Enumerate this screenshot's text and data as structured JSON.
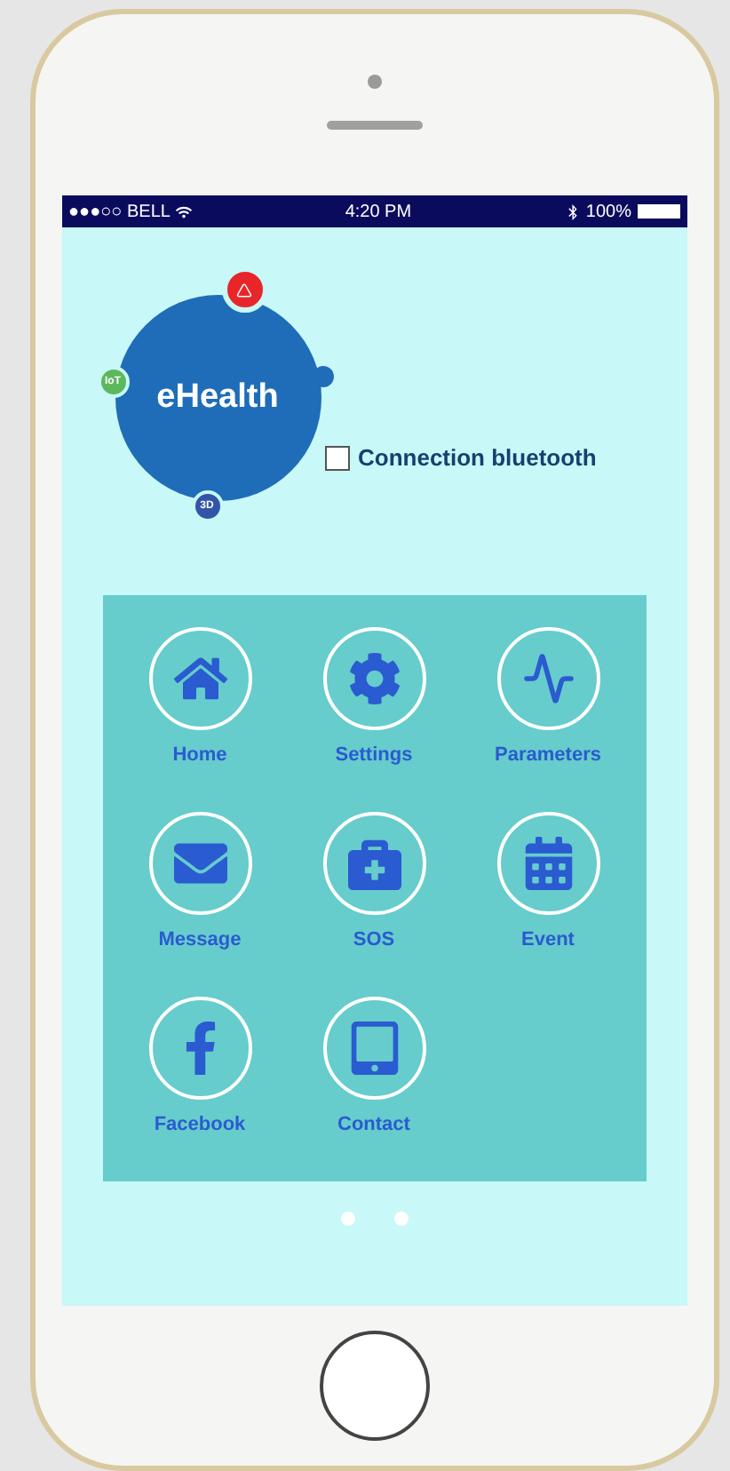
{
  "status_bar": {
    "carrier": "●●●○○ BELL",
    "time": "4:20 PM",
    "battery": "100%"
  },
  "logo": {
    "title": "eHealth",
    "badge_left": "IoT",
    "badge_bottom": "3D"
  },
  "bluetooth": {
    "label": "Connection bluetooth",
    "checked": false
  },
  "menu": [
    {
      "label": "Home",
      "kind": "home"
    },
    {
      "label": "Settings",
      "kind": "gear"
    },
    {
      "label": "Parameters",
      "kind": "pulse"
    },
    {
      "label": "Message",
      "kind": "envelope"
    },
    {
      "label": "SOS",
      "kind": "medkit"
    },
    {
      "label": "Event",
      "kind": "calendar"
    },
    {
      "label": "Facebook",
      "kind": "facebook"
    },
    {
      "label": "Contact",
      "kind": "tablet"
    }
  ]
}
